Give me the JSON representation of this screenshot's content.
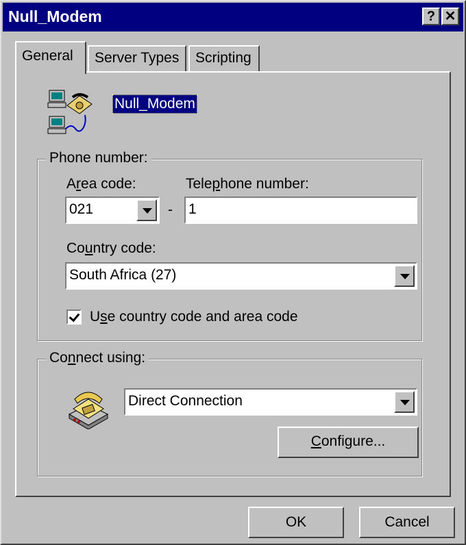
{
  "window": {
    "title": "Null_Modem",
    "help_glyph": "?",
    "close_glyph": "✕"
  },
  "tabs": [
    {
      "label": "General"
    },
    {
      "label": "Server Types"
    },
    {
      "label": "Scripting"
    }
  ],
  "entry": {
    "name": "Null_Modem",
    "icon": "networked-computers-phone-icon"
  },
  "phone": {
    "group_label": "Phone number:",
    "area_code_label_pre": "A",
    "area_code_label_acc": "r",
    "area_code_label_post": "ea code:",
    "area_code_value": "021",
    "separator": "-",
    "telephone_label_pre": "Tele",
    "telephone_label_acc": "p",
    "telephone_label_post": "hone number:",
    "telephone_value": "1",
    "country_label_pre": "Co",
    "country_label_acc": "u",
    "country_label_post": "ntry code:",
    "country_value": "South Africa (27)",
    "use_codes_pre": "U",
    "use_codes_acc": "s",
    "use_codes_post": "e country code and area code",
    "use_codes_checked": true
  },
  "connect": {
    "group_label_pre": "Co",
    "group_label_acc": "n",
    "group_label_post": "nect using:",
    "device_value": "Direct Connection",
    "icon": "telephone-icon",
    "configure_acc": "C",
    "configure_post": "onfigure..."
  },
  "buttons": {
    "ok": "OK",
    "cancel": "Cancel"
  },
  "colors": {
    "face": "#c0c0c0",
    "titlebar": "#000080",
    "highlight": "#000080"
  }
}
